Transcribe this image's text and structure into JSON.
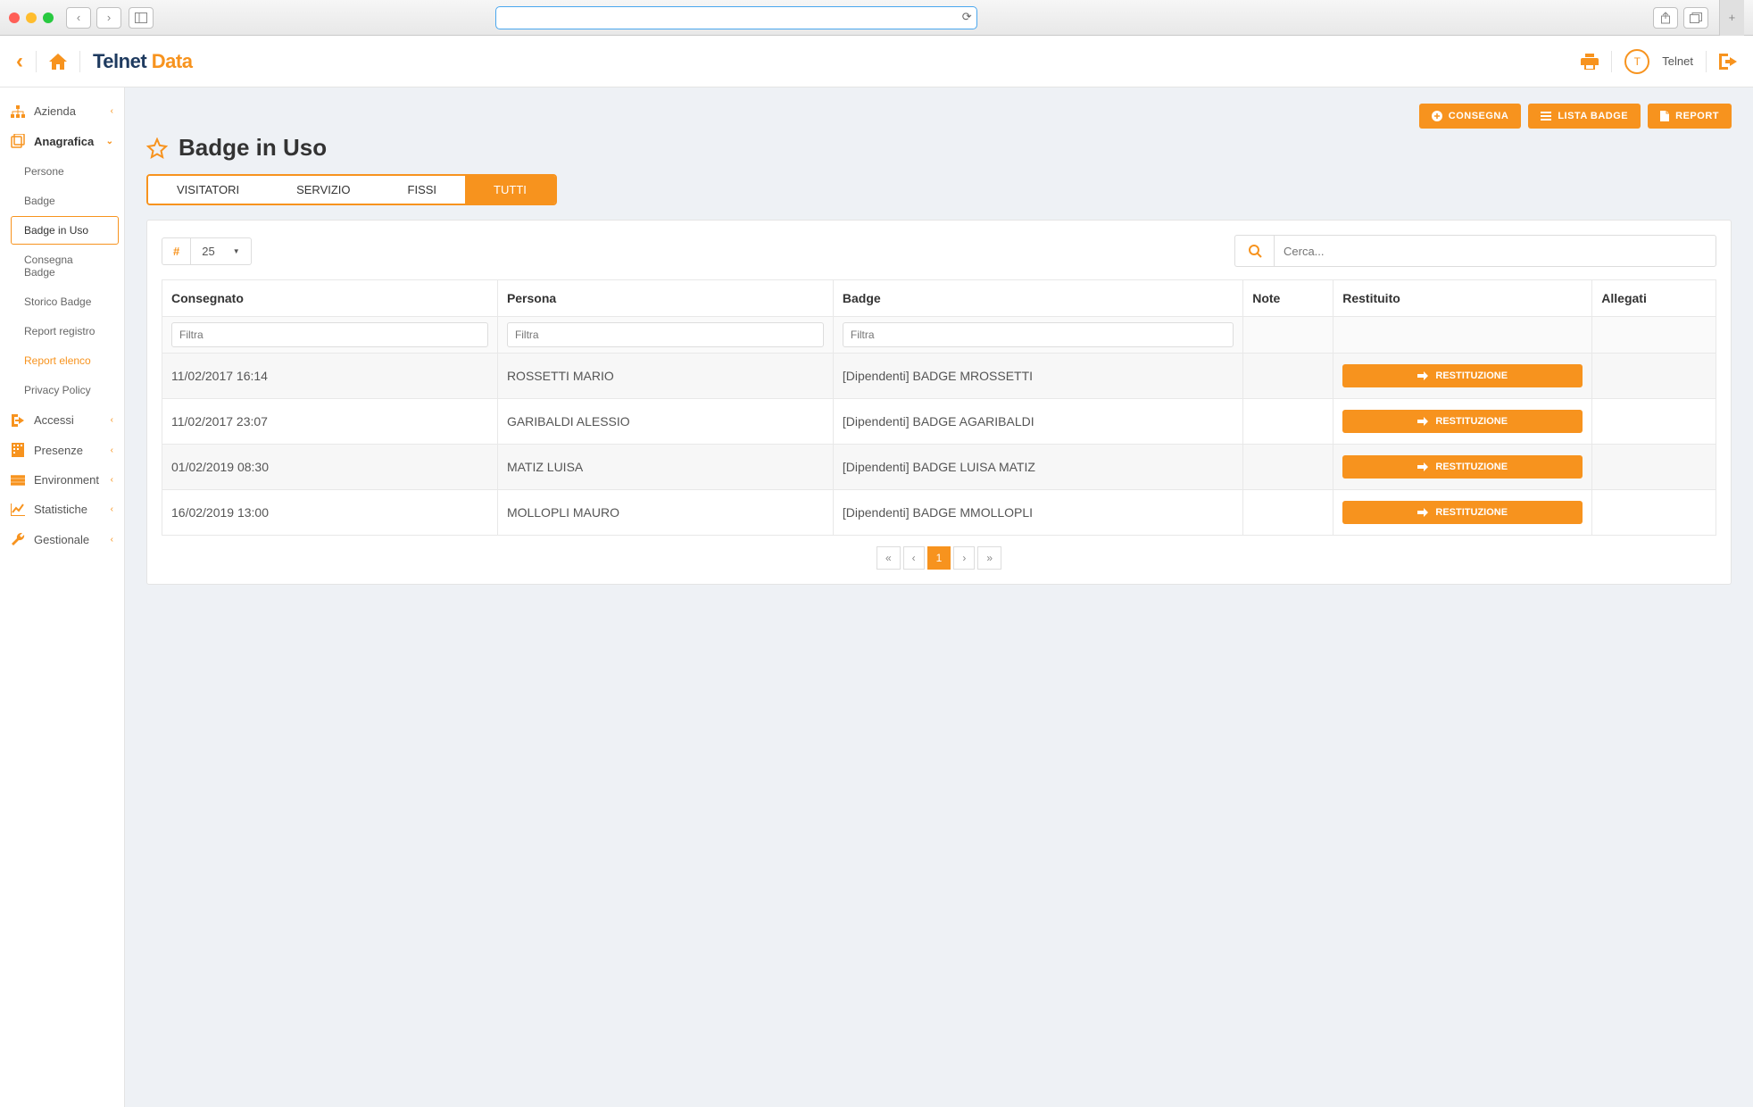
{
  "chrome": {
    "url": "",
    "share": "⇪",
    "tabs": "⧉",
    "plus": "+"
  },
  "header": {
    "brand1": "Telnet ",
    "brand2": "Data",
    "user_initial": "T",
    "user_name": "Telnet"
  },
  "sidebar": {
    "items": [
      {
        "label": "Azienda",
        "expandable": true
      },
      {
        "label": "Anagrafica",
        "expandable": true,
        "expanded": true,
        "children": [
          {
            "label": "Persone"
          },
          {
            "label": "Badge"
          },
          {
            "label": "Badge in Uso",
            "active": true
          },
          {
            "label": "Consegna Badge"
          },
          {
            "label": "Storico Badge"
          },
          {
            "label": "Report registro"
          },
          {
            "label": "Report elenco",
            "highlight": true
          },
          {
            "label": "Privacy Policy"
          }
        ]
      },
      {
        "label": "Accessi",
        "expandable": true
      },
      {
        "label": "Presenze",
        "expandable": true
      },
      {
        "label": "Environment",
        "expandable": true
      },
      {
        "label": "Statistiche",
        "expandable": true
      },
      {
        "label": "Gestionale",
        "expandable": true
      }
    ]
  },
  "page": {
    "title": "Badge in Uso",
    "actions": {
      "consegna": "CONSEGNA",
      "lista_badge": "LISTA BADGE",
      "report": "REPORT"
    },
    "tabs": [
      "VISITATORI",
      "SERVIZIO",
      "FISSI",
      "TUTTI"
    ],
    "active_tab": 3,
    "page_size": "25",
    "search_placeholder": "Cerca...",
    "columns": [
      "Consegnato",
      "Persona",
      "Badge",
      "Note",
      "Restituito",
      "Allegati"
    ],
    "filter_placeholder": "Filtra",
    "restituzione_label": "RESTITUZIONE",
    "rows": [
      {
        "consegnato": "11/02/2017 16:14",
        "persona": "ROSSETTI MARIO",
        "badge": "[Dipendenti] BADGE MROSSETTI",
        "note": ""
      },
      {
        "consegnato": "11/02/2017 23:07",
        "persona": "GARIBALDI ALESSIO",
        "badge": "[Dipendenti] BADGE AGARIBALDI",
        "note": ""
      },
      {
        "consegnato": "01/02/2019 08:30",
        "persona": "MATIZ LUISA",
        "badge": "[Dipendenti] BADGE LUISA MATIZ",
        "note": ""
      },
      {
        "consegnato": "16/02/2019 13:00",
        "persona": "MOLLOPLI MAURO",
        "badge": "[Dipendenti] BADGE MMOLLOPLI",
        "note": ""
      }
    ],
    "pager": {
      "current": "1"
    }
  }
}
